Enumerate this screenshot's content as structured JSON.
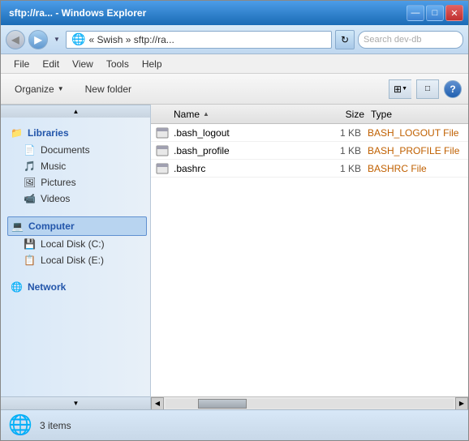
{
  "window": {
    "title": "sftp://ra... - Windows Explorer",
    "controls": {
      "minimize": "—",
      "maximize": "□",
      "close": "✕"
    }
  },
  "addressBar": {
    "back_label": "◀",
    "forward_label": "▶",
    "dropdown_label": "▼",
    "icon": "🌐",
    "path": "« Swish » sftp://ra...",
    "refresh_label": "↻",
    "search_placeholder": "Search dev-db"
  },
  "menu": {
    "items": [
      "File",
      "Edit",
      "View",
      "Tools",
      "Help"
    ]
  },
  "toolbar": {
    "organize_label": "Organize",
    "organize_arrow": "▼",
    "new_folder_label": "New folder",
    "view_grid_label": "⊞",
    "view_detail_label": "≡",
    "view_dropdown": "▼",
    "view_pane_label": "□",
    "help_label": "?"
  },
  "sidebar": {
    "scroll_up": "▲",
    "scroll_down": "▼",
    "sections": [
      {
        "header": "Libraries",
        "icon": "📁",
        "items": [
          {
            "label": "Documents",
            "icon": "📄"
          },
          {
            "label": "Music",
            "icon": "🎵"
          },
          {
            "label": "Pictures",
            "icon": "🖼"
          },
          {
            "label": "Videos",
            "icon": "📹"
          }
        ]
      },
      {
        "header": "Computer",
        "icon": "💻",
        "selected": true,
        "items": [
          {
            "label": "Local Disk (C:)",
            "icon": "💾"
          },
          {
            "label": "Local Disk (E:)",
            "icon": "📋"
          }
        ]
      },
      {
        "header": "Network",
        "icon": "🌐",
        "items": []
      }
    ]
  },
  "fileList": {
    "columns": [
      {
        "label": "Name",
        "sort": "▲"
      },
      {
        "label": "Size"
      },
      {
        "label": "Type"
      }
    ],
    "files": [
      {
        "name": ".bash_logout",
        "size": "1 KB",
        "type": "BASH_LOGOUT File"
      },
      {
        "name": ".bash_profile",
        "size": "1 KB",
        "type": "BASH_PROFILE File"
      },
      {
        "name": ".bashrc",
        "size": "1 KB",
        "type": "BASHRC File"
      }
    ]
  },
  "statusBar": {
    "icon": "🌐",
    "text": "3 items"
  },
  "hscrollbar": {
    "left": "◀",
    "right": "▶"
  }
}
